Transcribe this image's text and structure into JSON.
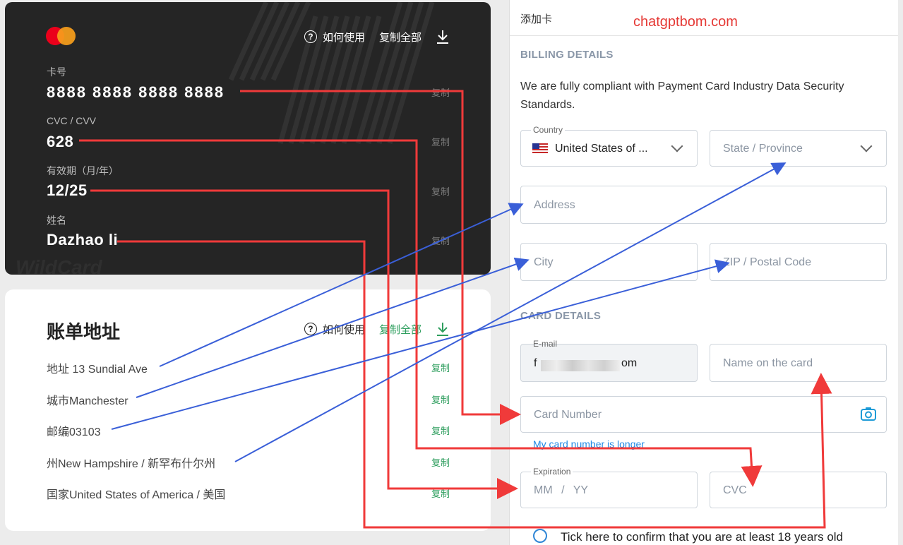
{
  "card": {
    "help_label": "如何使用",
    "copy_all_label": "复制全部",
    "watermark": "WildCard",
    "fields": [
      {
        "label": "卡号",
        "value": "8888 8888 8888 8888",
        "copy": "复制"
      },
      {
        "label": "CVC / CVV",
        "value": "628",
        "copy": "复制"
      },
      {
        "label": "有效期（月/年）",
        "value": "12/25",
        "copy": "复制"
      },
      {
        "label": "姓名",
        "value": "Dazhao li",
        "copy": "复制"
      }
    ]
  },
  "billing": {
    "title": "账单地址",
    "help_label": "如何使用",
    "copy_all_label": "复制全部",
    "rows": [
      {
        "text": "地址 13 Sundial Ave",
        "copy": "复制"
      },
      {
        "text": "城市Manchester",
        "copy": "复制"
      },
      {
        "text": "邮编03103",
        "copy": "复制"
      },
      {
        "text": "州New Hampshire / 新罕布什尔州",
        "copy": "复制"
      },
      {
        "text": "国家United States of America / 美国",
        "copy": "复制"
      }
    ]
  },
  "form": {
    "header_title": "添加卡",
    "site_watermark": "chatgptbom.com",
    "billing_section": "BILLING DETAILS",
    "compliance_text": "We are fully compliant with Payment Card Industry Data Security Standards.",
    "country_label": "Country",
    "country_value": "United States of ...",
    "state_placeholder": "State / Province",
    "address_placeholder": "Address",
    "city_placeholder": "City",
    "zip_placeholder": "ZIP / Postal Code",
    "card_section": "CARD DETAILS",
    "email_label": "E-mail",
    "email_prefix": "f",
    "email_suffix": "om",
    "name_placeholder": "Name on the card",
    "card_number_placeholder": "Card Number",
    "longer_link": "My card number is longer",
    "expiration_label": "Expiration",
    "expiration_placeholder": "MM / YY",
    "cvc_placeholder": "CVC",
    "age_confirm": "Tick here to confirm that you are at least 18 years old"
  },
  "colors": {
    "card_bg": "#252525",
    "copy_green": "#2e9e5e",
    "arrow_red": "#f03a3a",
    "arrow_blue": "#3a5fd8",
    "link_blue": "#1e88e5",
    "watermark_red": "#e53935"
  }
}
